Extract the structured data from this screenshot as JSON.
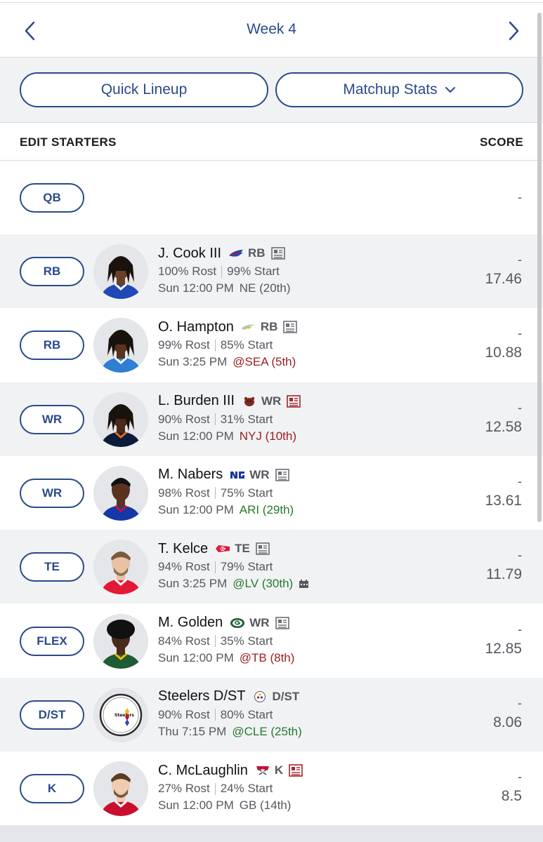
{
  "nav": {
    "week_label": "Week 4"
  },
  "actions": {
    "quick_lineup": "Quick Lineup",
    "matchup_stats": "Matchup Stats"
  },
  "table_header": {
    "left": "EDIT STARTERS",
    "right": "SCORE"
  },
  "qb_row": {
    "slot": "QB",
    "score": "-"
  },
  "players": [
    {
      "slot": "RB",
      "name": "J. Cook III",
      "team_icon": "bills-logo",
      "pos": "RB",
      "rost": "100% Rost",
      "start": "99% Start",
      "time": "Sun 12:00 PM",
      "opp": "NE (20th)",
      "opp_tone": "neutral",
      "proj": "-",
      "score": "17.46",
      "news_color": "#6b6e74"
    },
    {
      "slot": "RB",
      "name": "O. Hampton",
      "team_icon": "chargers-logo",
      "pos": "RB",
      "rost": "99% Rost",
      "start": "85% Start",
      "time": "Sun 3:25 PM",
      "opp": "@SEA (5th)",
      "opp_tone": "bad",
      "proj": "-",
      "score": "10.88",
      "news_color": "#6b6e74"
    },
    {
      "slot": "WR",
      "name": "L. Burden III",
      "team_icon": "bears-logo",
      "pos": "WR",
      "rost": "90% Rost",
      "start": "31% Start",
      "time": "Sun 12:00 PM",
      "opp": "NYJ (10th)",
      "opp_tone": "bad",
      "proj": "-",
      "score": "12.58",
      "news_color": "#a3262b"
    },
    {
      "slot": "WR",
      "name": "M. Nabers",
      "team_icon": "giants-logo",
      "pos": "WR",
      "rost": "98% Rost",
      "start": "75% Start",
      "time": "Sun 12:00 PM",
      "opp": "ARI (29th)",
      "opp_tone": "good",
      "proj": "-",
      "score": "13.61",
      "news_color": "#6b6e74"
    },
    {
      "slot": "TE",
      "name": "T. Kelce",
      "team_icon": "chiefs-logo",
      "pos": "TE",
      "rost": "94% Rost",
      "start": "79% Start",
      "time": "Sun 3:25 PM",
      "opp": "@LV (30th)",
      "opp_tone": "good",
      "proj": "-",
      "score": "11.79",
      "news_color": "#6b6e74",
      "indoor_icon": true
    },
    {
      "slot": "FLEX",
      "name": "M. Golden",
      "team_icon": "packers-logo",
      "pos": "WR",
      "rost": "84% Rost",
      "start": "35% Start",
      "time": "Sun 12:00 PM",
      "opp": "@TB (8th)",
      "opp_tone": "bad",
      "proj": "-",
      "score": "12.85",
      "news_color": "#6b6e74"
    },
    {
      "slot": "D/ST",
      "name": "Steelers D/ST",
      "team_icon": "steelers-logo",
      "pos": "D/ST",
      "rost": "90% Rost",
      "start": "80% Start",
      "time": "Thu 7:15 PM",
      "opp": "@CLE (25th)",
      "opp_tone": "good",
      "proj": "-",
      "score": "8.06",
      "no_news": true
    },
    {
      "slot": "K",
      "name": "C. McLaughlin",
      "team_icon": "buccaneers-logo",
      "pos": "K",
      "rost": "27% Rost",
      "start": "24% Start",
      "time": "Sun 12:00 PM",
      "opp": "GB (14th)",
      "opp_tone": "neutral",
      "proj": "-",
      "score": "8.5",
      "news_color": "#a3262b"
    }
  ],
  "colors": {
    "accent": "#2a4a8a",
    "good": "#247a2e",
    "bad": "#9b2020"
  }
}
